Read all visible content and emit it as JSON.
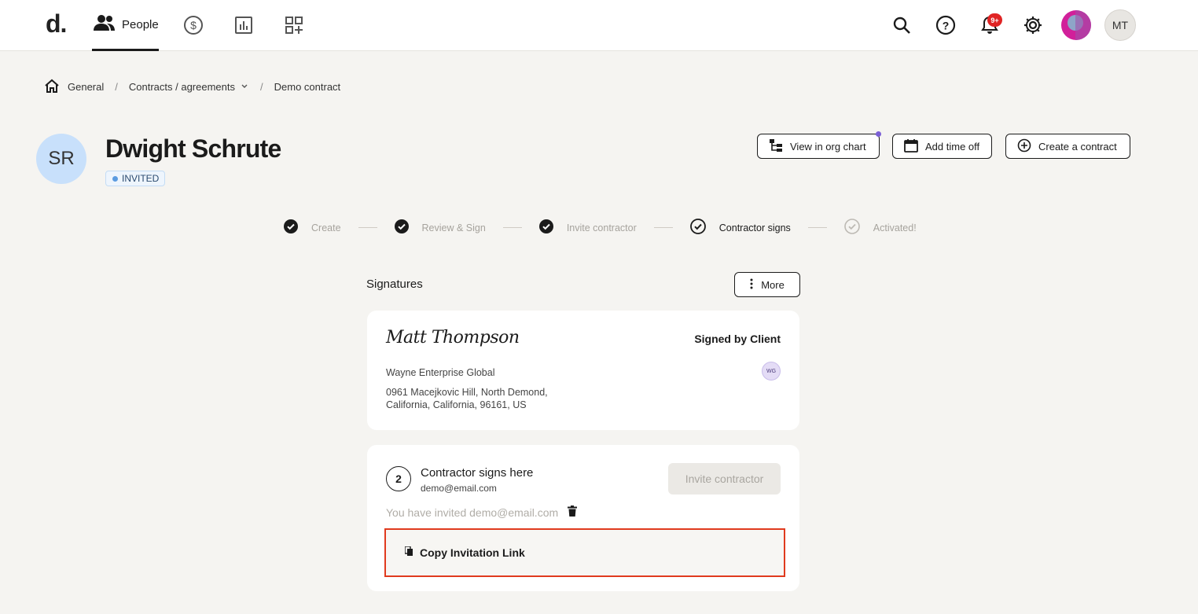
{
  "nav": {
    "logo": "d.",
    "people_label": "People",
    "notifications_count": "9+",
    "user_initials": "MT"
  },
  "breadcrumb": {
    "home": "General",
    "section": "Contracts / agreements",
    "current": "Demo contract"
  },
  "header": {
    "initials": "SR",
    "name": "Dwight Schrute",
    "status": "INVITED",
    "buttons": {
      "org_chart": "View in org chart",
      "time_off": "Add time off",
      "create_contract": "Create a contract"
    }
  },
  "stepper": {
    "steps": [
      {
        "label": "Create",
        "state": "done"
      },
      {
        "label": "Review & Sign",
        "state": "done"
      },
      {
        "label": "Invite contractor",
        "state": "done"
      },
      {
        "label": "Contractor signs",
        "state": "current"
      },
      {
        "label": "Activated!",
        "state": "pending"
      }
    ]
  },
  "signatures": {
    "title": "Signatures",
    "more_label": "More",
    "client": {
      "signature": "Matt Thompson",
      "signed_label": "Signed by Client",
      "badge": "WG",
      "company": "Wayne Enterprise Global",
      "address_line1": "0961 Macejkovic Hill, North Demond,",
      "address_line2": "California, California, 96161, US"
    },
    "contractor": {
      "step_number": "2",
      "title": "Contractor signs here",
      "email": "demo@email.com",
      "invite_button": "Invite contractor",
      "invited_note": "You have invited demo@email.com",
      "copy_link_label": "Copy Invitation Link"
    }
  },
  "colors": {
    "accent_highlight": "#e03a1e",
    "status_dot": "#5b9be0",
    "notification": "#e02424"
  }
}
